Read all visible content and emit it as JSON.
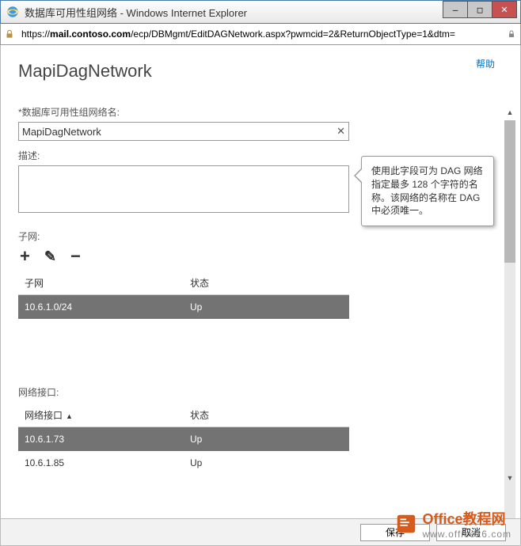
{
  "window": {
    "title": "数据库可用性组网络 - Windows Internet Explorer"
  },
  "address": {
    "host": "mail.contoso.com",
    "path": "/ecp/DBMgmt/EditDAGNetwork.aspx?pwmcid=2&ReturnObjectType=1&dtm="
  },
  "help": "帮助",
  "page": {
    "title": "MapiDagNetwork",
    "name_label": "*数据库可用性组网络名:",
    "name_value": "MapiDagNetwork",
    "desc_label": "描述:",
    "desc_value": "",
    "subnet_label": "子网:",
    "subnet_table": {
      "headers": [
        "子网",
        "状态"
      ],
      "rows": [
        {
          "subnet": "10.6.1.0/24",
          "status": "Up",
          "selected": true
        }
      ]
    },
    "iface_label": "网络接口:",
    "iface_table": {
      "headers": [
        "网络接口",
        "状态"
      ],
      "rows": [
        {
          "iface": "10.6.1.73",
          "status": "Up",
          "selected": true
        },
        {
          "iface": "10.6.1.85",
          "status": "Up",
          "selected": false
        }
      ]
    }
  },
  "callout": "使用此字段可为 DAG 网络指定最多 128 个字符的名称。该网络的名称在 DAG 中必须唯一。",
  "footer": {
    "save": "保存",
    "cancel": "取消"
  },
  "watermark": {
    "brand": "Office教程网",
    "url": "www.office26.com"
  }
}
